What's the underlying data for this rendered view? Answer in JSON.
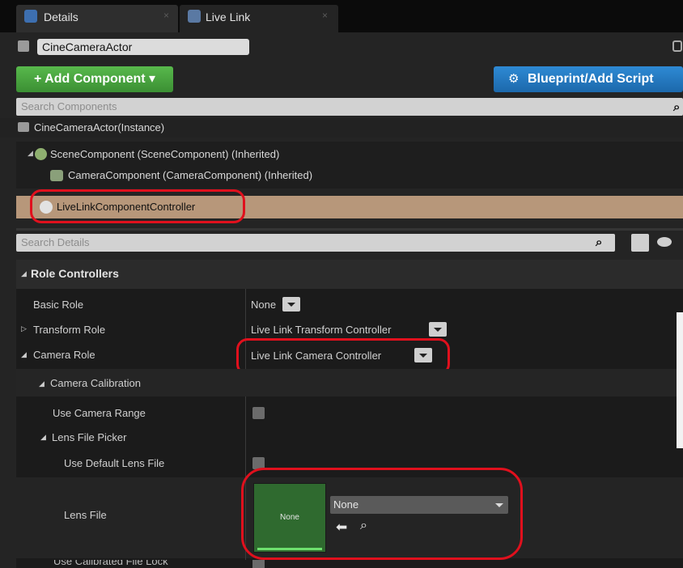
{
  "tabs": [
    {
      "label": "Details",
      "icon": "details-icon",
      "close": "×"
    },
    {
      "label": "Live Link",
      "icon": "live-link-icon",
      "close": "×"
    }
  ],
  "actor": {
    "name": "CineCameraActor",
    "lock_icon": "lock-icon"
  },
  "buttons": {
    "add_component": "+ Add Component ▾",
    "blueprint": "Blueprint/Add Script"
  },
  "components_search": {
    "placeholder": "Search Components"
  },
  "components": [
    {
      "label": "CineCameraActor(Instance)",
      "icon": "actor-icon"
    },
    {
      "label": "SceneComponent (SceneComponent) (Inherited)",
      "icon": "scene-component-icon",
      "expand": "◢"
    },
    {
      "label": "CameraComponent (CameraComponent) (Inherited)",
      "icon": "camera-component-icon"
    },
    {
      "label": "LiveLinkComponentController",
      "icon": "live-link-controller-icon"
    }
  ],
  "details_search": {
    "placeholder": "Search Details"
  },
  "details": {
    "section": "Role Controllers",
    "basic_role": {
      "label": "Basic Role",
      "value": "None"
    },
    "transform_role": {
      "label": "Transform Role",
      "value": "Live Link Transform Controller"
    },
    "camera_role": {
      "label": "Camera Role",
      "value": "Live Link Camera Controller"
    },
    "camera_calibration": "Camera Calibration",
    "use_camera_range": "Use Camera Range",
    "lens_file_picker": "Lens File Picker",
    "use_default_lens_file": "Use Default Lens File",
    "lens_file": {
      "label": "Lens File",
      "thumb_text": "None",
      "value": "None"
    },
    "next_row_partial": "Use Calibrated File Lock"
  },
  "colors": {
    "selected_row": "#b7977a",
    "highlight": "#e0101d",
    "add_button": "#4aa83f",
    "blueprint_button": "#2478c0"
  }
}
